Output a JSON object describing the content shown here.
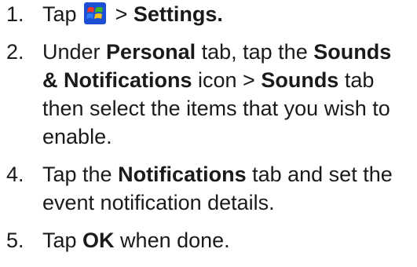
{
  "steps": [
    {
      "number": "1.",
      "t1": "Tap",
      "icon": "windows-start-icon",
      "t2": " > ",
      "b1": "Settings."
    },
    {
      "number": "2.",
      "t1": "Under ",
      "b1": "Personal",
      "t2": " tab, tap the ",
      "b2": "Sounds & Notifications",
      "t3": " icon > ",
      "b3": "Sounds",
      "t4": " tab then select the items that you wish to enable."
    },
    {
      "number": "4.",
      "t1": "Tap the ",
      "b1": "Notifications",
      "t2": " tab and set the event notification details."
    },
    {
      "number": "5.",
      "t1": "Tap ",
      "b1": "OK",
      "t2": " when done."
    }
  ]
}
